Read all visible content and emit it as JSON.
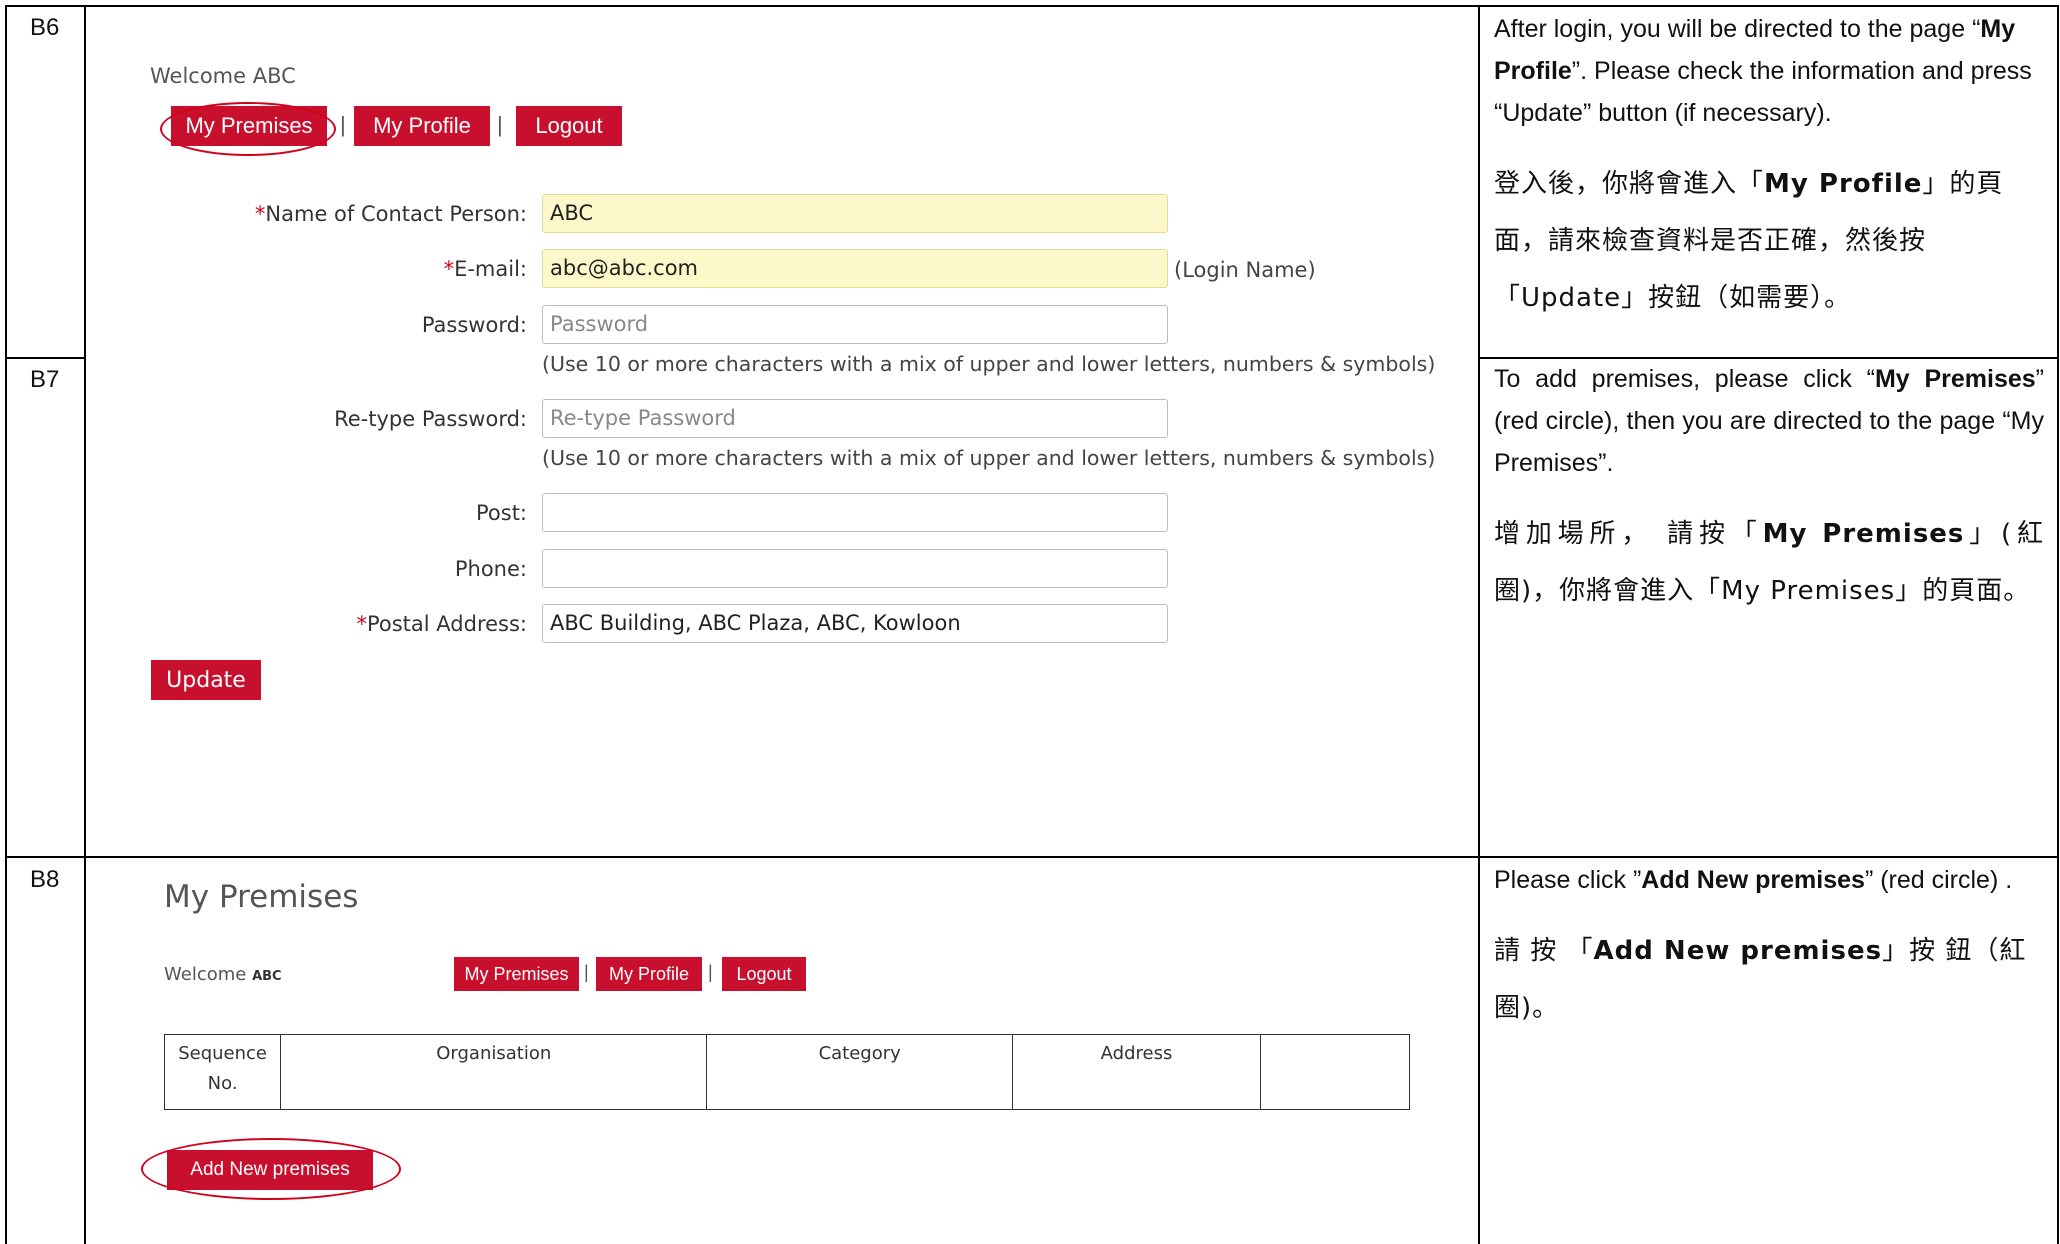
{
  "rows": [
    {
      "label": "B6",
      "desc_en": [
        {
          "t": "After login, you will be directed to the page “"
        },
        {
          "t": "My Profile",
          "b": true
        },
        {
          "t": "”. Please check the information and press “Update” button (if necessary)."
        }
      ],
      "desc_zh": [
        {
          "t": "登入後，你將會進入「"
        },
        {
          "t": "My Profile",
          "b": true
        },
        {
          "t": "」的頁面，請來檢查資料是否正確，然後按「Update」按鈕（如需要）。"
        }
      ]
    },
    {
      "label": "B7",
      "desc_en": [
        {
          "t": "To add premises, please click “"
        },
        {
          "t": "My Premises",
          "b": true
        },
        {
          "t": "” (red circle), then you are directed to the page “My Premises”."
        }
      ],
      "desc_zh": [
        {
          "t": "增加場所， 請按「"
        },
        {
          "t": "My Premises",
          "b": true
        },
        {
          "t": "」(紅圈)，你將會進入「My Premises」的頁面。"
        }
      ]
    },
    {
      "label": "B8",
      "desc_en": [
        {
          "t": "Please click ”"
        },
        {
          "t": "Add New premises",
          "b": true
        },
        {
          "t": "” (red circle) ."
        }
      ],
      "desc_zh": [
        {
          "t": "請 按 「"
        },
        {
          "t": "Add New premises",
          "b": true
        },
        {
          "t": "」按 鈕（紅圈)。"
        }
      ]
    }
  ],
  "profile_screen": {
    "welcome": "Welcome ABC",
    "nav": {
      "premises": "My Premises",
      "sep1": "|",
      "profile": "My Profile",
      "sep2": "|",
      "logout": "Logout"
    },
    "fields": {
      "contact": {
        "req": "*",
        "label": "Name of Contact Person:",
        "value": "ABC"
      },
      "email": {
        "req": "*",
        "label": "E-mail:",
        "value": "abc@abc.com",
        "suffix": "(Login Name)"
      },
      "password": {
        "label": "Password:",
        "placeholder": "Password"
      },
      "retype": {
        "label": "Re-type Password:",
        "placeholder": "Re-type Password"
      },
      "post": {
        "label": "Post:",
        "value": ""
      },
      "phone": {
        "label": "Phone:",
        "value": ""
      },
      "address": {
        "req": "*",
        "label": "Postal Address:",
        "value": "ABC Building, ABC Plaza, ABC, Kowloon"
      }
    },
    "password_hint": "(Use 10 or more characters with a mix of upper and lower letters, numbers & symbols)",
    "update_button": "Update"
  },
  "premises_screen": {
    "title": "My Premises",
    "welcome_label": "Welcome",
    "welcome_name": "ABC",
    "nav": {
      "premises": "My Premises",
      "sep1": "|",
      "profile": "My Profile",
      "sep2": "|",
      "logout": "Logout"
    },
    "table_headers": {
      "seq": "Sequence No.",
      "org": "Organisation",
      "cat": "Category",
      "addr": "Address",
      "blank": ""
    },
    "add_button": "Add New premises"
  }
}
